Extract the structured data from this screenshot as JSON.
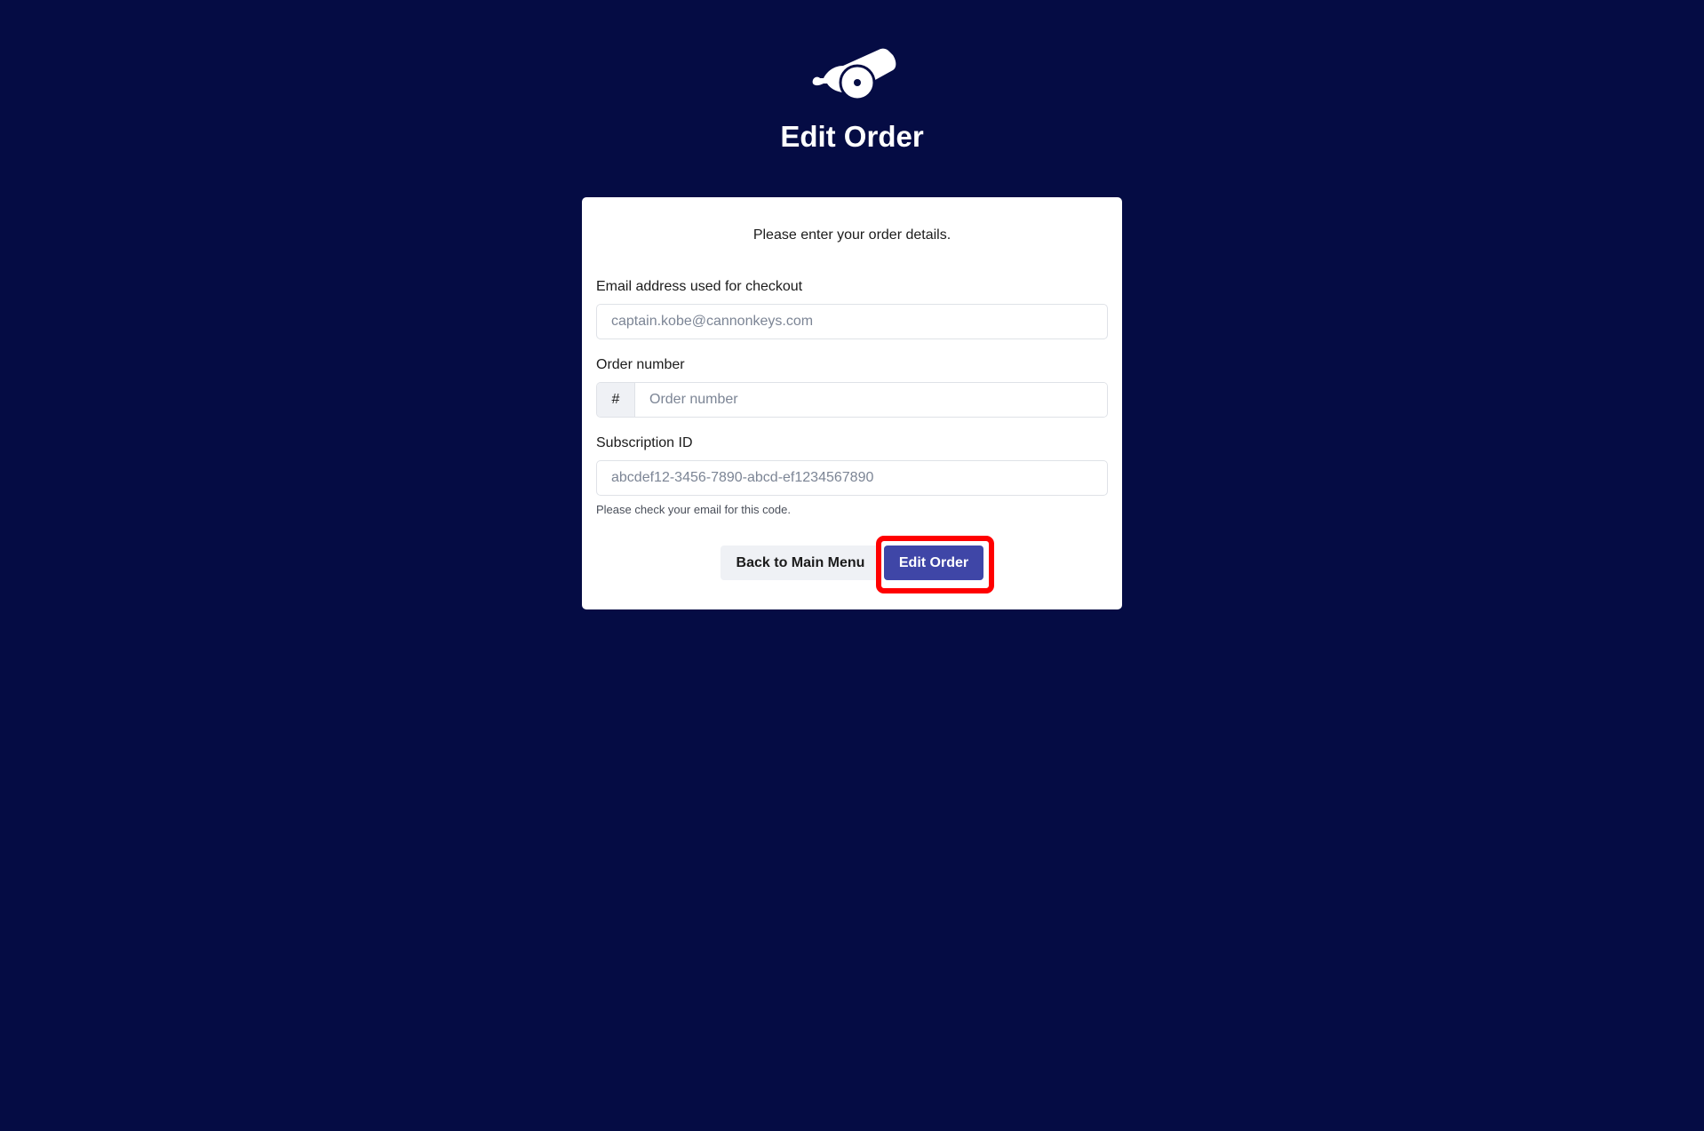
{
  "page": {
    "title": "Edit Order",
    "logo_icon": "cannon-icon"
  },
  "form": {
    "intro": "Please enter your order details.",
    "email": {
      "label": "Email address used for checkout",
      "value": "",
      "placeholder": "captain.kobe@cannonkeys.com"
    },
    "order_number": {
      "label": "Order number",
      "prefix": "#",
      "value": "",
      "placeholder": "Order number"
    },
    "subscription_id": {
      "label": "Subscription ID",
      "value": "",
      "placeholder": "abcdef12-3456-7890-abcd-ef1234567890",
      "help": "Please check your email for this code."
    }
  },
  "actions": {
    "back_label": "Back to Main Menu",
    "submit_label": "Edit Order"
  },
  "colors": {
    "background": "#050c44",
    "card": "#ffffff",
    "primary_button": "#3f46a7",
    "secondary_button": "#eff1f5",
    "highlight": "#ff0000"
  }
}
